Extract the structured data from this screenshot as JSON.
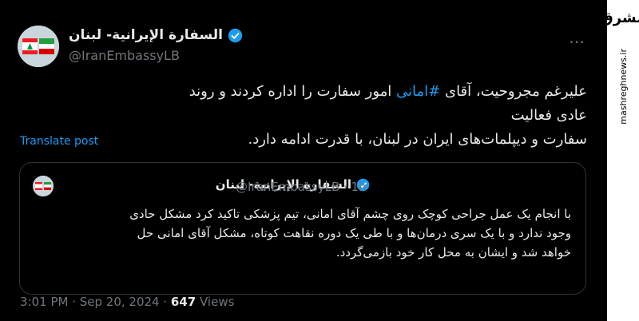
{
  "account": {
    "name": "السفارة الإيرانية- لبنان",
    "handle": "@IranEmbassyLB"
  },
  "menu": {
    "more_label": "⋯"
  },
  "post": {
    "line1_a": "علیرغم مجروحیت، آقای ",
    "hashtag": "#امانی",
    "line1_b": " امور سفارت را اداره کردند و روند عادی فعالیت",
    "line2": "سفارت و دیپلمات‌های ایران در لبنان، با قدرت ادامه دارد."
  },
  "translate_label": "Translate post",
  "quoted": {
    "name": "السفارة الإيرانية- لبنان",
    "handle_time": "@IranEmbassyLB · 1h",
    "line1": "با انجام یک عمل جراحی کوچک روی چشم آقای امانی، تیم پزشکی تاکید کرد مشکل حادی",
    "line2": "وجود ندارد و با یک سری درمان‌ها و با طی یک دوره نقاهت کوتاه، مشکل آقای امانی حل",
    "line3": "خواهد شد و ایشان به محل کار خود بازمی‌گردد."
  },
  "meta": {
    "time": "3:01 PM",
    "sep1": " · ",
    "date": "Sep 20, 2024",
    "sep2": " · ",
    "views_count": "647",
    "views_label": " Views"
  },
  "watermark": {
    "logo": "مشرق",
    "url": "mashreghnews.ir"
  },
  "colors": {
    "background": "#000000",
    "link": "#1d9bf0",
    "muted": "#71767b",
    "text": "#e7e9ea"
  }
}
